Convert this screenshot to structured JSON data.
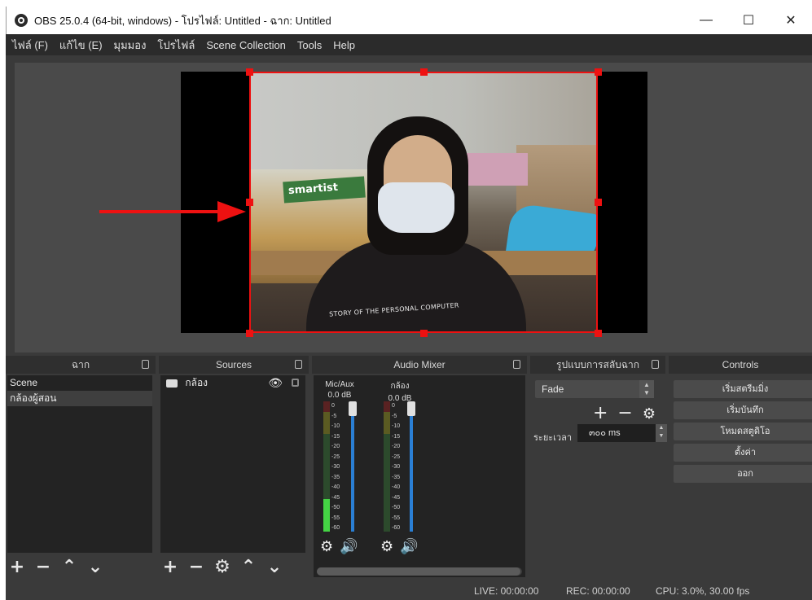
{
  "window": {
    "title": "OBS 25.0.4 (64-bit, windows) - โปรไฟล์: Untitled - ฉาก: Untitled",
    "minimize": "—",
    "maximize": "☐",
    "close": "✕"
  },
  "menu": [
    "ไฟล์ (F)",
    "แก้ไข (E)",
    "มุมมอง",
    "โปรไฟล์",
    "Scene Collection",
    "Tools",
    "Help"
  ],
  "preview": {
    "box_label": "smartist",
    "shirt_text": "STORY OF THE PERSONAL COMPUTER",
    "accent_red": "#e11111"
  },
  "scenes": {
    "title": "ฉาก",
    "items": [
      "Scene",
      "กล้องผู้สอน"
    ],
    "selected": 1
  },
  "sources": {
    "title": "Sources",
    "items": [
      {
        "label": "กล้อง",
        "icon": "camera-icon",
        "visible_icon": "eye-icon",
        "lock_icon": "lock-icon"
      }
    ]
  },
  "audio_mixer": {
    "title": "Audio Mixer",
    "channels": [
      {
        "name": "Mic/Aux",
        "db": "0.0 dB",
        "level": 0.25
      },
      {
        "name": "กล้อง",
        "db": "0.0 dB",
        "level": 0.0
      }
    ],
    "ticks": [
      "0",
      "-5",
      "-10",
      "-15",
      "-20",
      "-25",
      "-30",
      "-35",
      "-40",
      "-45",
      "-50",
      "-55",
      "-60"
    ]
  },
  "transitions": {
    "title": "รูปแบบการสลับฉาก",
    "selected": "Fade",
    "duration_label": "ระยะเวลา",
    "duration_value": "๓๐๐ ms"
  },
  "controls": {
    "title": "Controls",
    "buttons": [
      "เริ่มสตรีมมิ่ง",
      "เริ่มบันทึก",
      "โหมดสตูดิโอ",
      "ตั้งค่า",
      "ออก"
    ]
  },
  "status": {
    "live": "LIVE: 00:00:00",
    "rec": "REC: 00:00:00",
    "cpu": "CPU: 3.0%, 30.00 fps"
  }
}
